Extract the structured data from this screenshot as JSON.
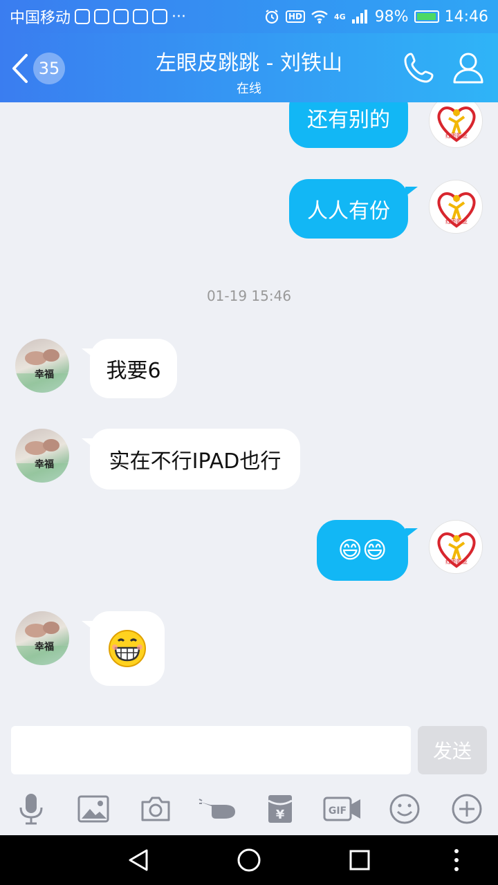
{
  "status_bar": {
    "carrier": "中国移动",
    "overflow": "···",
    "hd": "HD",
    "network": "4G",
    "battery": "98%",
    "battery_level": 0.98,
    "time": "14:46"
  },
  "header": {
    "unread_count": "35",
    "title": "左眼皮跳跳 - 刘铁山",
    "status": "在线"
  },
  "messages": [
    {
      "side": "self",
      "text": "还有别的"
    },
    {
      "side": "self",
      "text": "人人有份"
    },
    {
      "side": "self",
      "text": "😄😄"
    },
    {
      "side": "other",
      "text": "我要6"
    },
    {
      "side": "other",
      "text": "实在不行IPAD也行"
    },
    {
      "side": "other",
      "sticker": "big-grin-emoji"
    }
  ],
  "timestamp": "01-19 15:46",
  "avatars": {
    "other_caption": "幸福",
    "self_caption": "红图影业"
  },
  "composer": {
    "placeholder": "",
    "send_label": "发送"
  },
  "toolbar": {
    "items": [
      "microphone-icon",
      "image-icon",
      "camera-icon",
      "poke-icon",
      "red-packet-icon",
      "gif-icon",
      "emoji-icon",
      "plus-icon"
    ],
    "gif_label": "GIF",
    "yen": "¥"
  },
  "colors": {
    "header_start": "#3a7df0",
    "header_end": "#2fb4f7",
    "self_bubble": "#12b7f5",
    "background": "#eef0f5"
  }
}
